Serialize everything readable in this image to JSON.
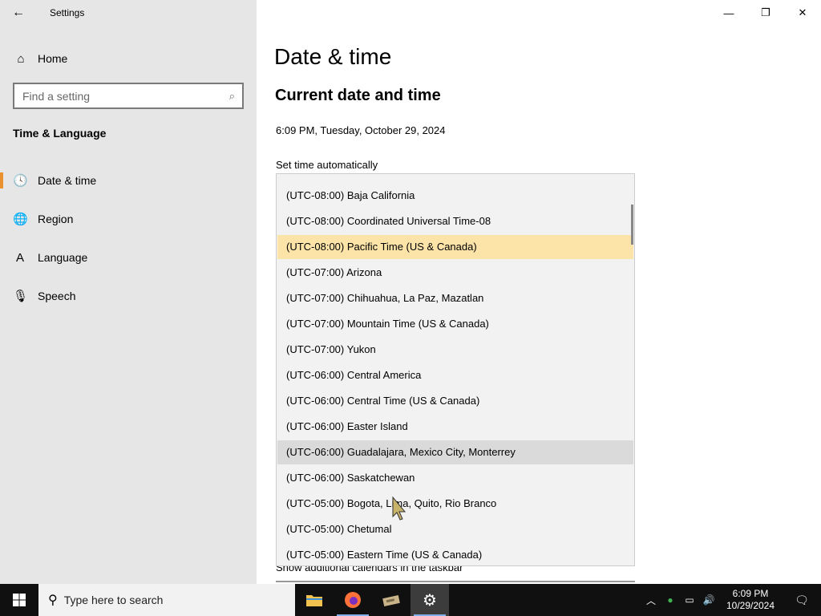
{
  "window": {
    "app_title": "Settings",
    "back_icon": "←",
    "minimize_icon": "—",
    "maximize_icon": "❐",
    "close_icon": "✕"
  },
  "sidebar": {
    "home_label": "Home",
    "home_icon": "⌂",
    "search_placeholder": "Find a setting",
    "search_icon": "⌕",
    "section_label": "Time & Language",
    "items": [
      {
        "label": "Date & time",
        "icon": "🕓"
      },
      {
        "label": "Region",
        "icon": "🌐"
      },
      {
        "label": "Language",
        "icon": "A"
      },
      {
        "label": "Speech",
        "icon": "🎙"
      }
    ],
    "active_color": "#e8912d"
  },
  "main": {
    "page_title": "Date & time",
    "section_title": "Current date and time",
    "current_datetime": "6:09 PM, Tuesday, October 29, 2024",
    "set_time_auto_label": "Set time automatically",
    "additional_calendars_label": "Show additional calendars in the taskbar"
  },
  "timezone_dropdown": {
    "items": [
      "(UTC-08:00) Baja California",
      "(UTC-08:00) Coordinated Universal Time-08",
      "(UTC-08:00) Pacific Time (US & Canada)",
      "(UTC-07:00) Arizona",
      "(UTC-07:00) Chihuahua, La Paz, Mazatlan",
      "(UTC-07:00) Mountain Time (US & Canada)",
      "(UTC-07:00) Yukon",
      "(UTC-06:00) Central America",
      "(UTC-06:00) Central Time (US & Canada)",
      "(UTC-06:00) Easter Island",
      "(UTC-06:00) Guadalajara, Mexico City, Monterrey",
      "(UTC-06:00) Saskatchewan",
      "(UTC-05:00) Bogota, Lima, Quito, Rio Branco",
      "(UTC-05:00) Chetumal",
      "(UTC-05:00) Eastern Time (US & Canada)"
    ],
    "selected": "(UTC-08:00) Pacific Time (US & Canada)",
    "hovered": "(UTC-06:00) Guadalajara, Mexico City, Monterrey",
    "selected_color": "#fce4a9",
    "hover_color": "#dadada"
  },
  "taskbar": {
    "search_placeholder": "Type here to search",
    "clock_time": "6:09 PM",
    "clock_date": "10/29/2024",
    "apps": [
      "file-explorer",
      "firefox",
      "app-3",
      "settings"
    ]
  }
}
